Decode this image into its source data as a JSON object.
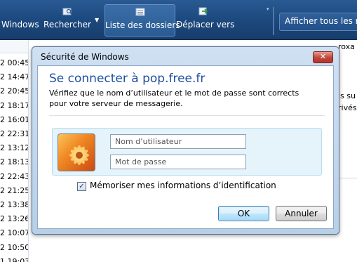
{
  "toolbar": {
    "windows_label": "Windows",
    "rechercher_label": "Rechercher",
    "dossiers_label": "Liste des dossiers",
    "deplacer_label": "Déplacer vers",
    "afficher_label": "Afficher tous les me"
  },
  "message_list": {
    "times": [
      "2 00:45",
      "2 14:47",
      "2 20:45",
      "2 18:17",
      "2 16:01",
      "2 22:31",
      "2 13:12",
      "2 18:13",
      "2 22:43",
      "2 21:25",
      "2 13:38",
      "2 13:26",
      "2 10:07",
      "2 10:50",
      "1 19:03"
    ]
  },
  "preview": {
    "line1": "roxa",
    "line2": "is su",
    "line3": "rivés"
  },
  "dialog": {
    "title": "Sécurité de Windows",
    "close_glyph": "✕",
    "heading": "Se connecter à pop.free.fr",
    "description": "Vérifiez que le nom d’utilisateur et le mot de passe sont corrects pour votre serveur de messagerie.",
    "username_placeholder": "Nom d’utilisateur",
    "username_value": "",
    "password_placeholder": "Mot de passe",
    "password_value": "",
    "remember_label": "Mémoriser mes informations d’identification",
    "remember_checked": true,
    "ok_label": "OK",
    "cancel_label": "Annuler"
  },
  "icons": {
    "rechercher": "search-folder-icon",
    "dossiers": "folder-list-icon",
    "deplacer": "move-to-folder-icon",
    "avatar": "flower-avatar-icon",
    "close": "close-icon",
    "checkbox": "checkmark-icon"
  },
  "colors": {
    "toolbar_bg": "#1d4a80",
    "heading_blue": "#1f4fa1",
    "close_red": "#c0443a",
    "panel_bg": "#e5f3fb"
  }
}
